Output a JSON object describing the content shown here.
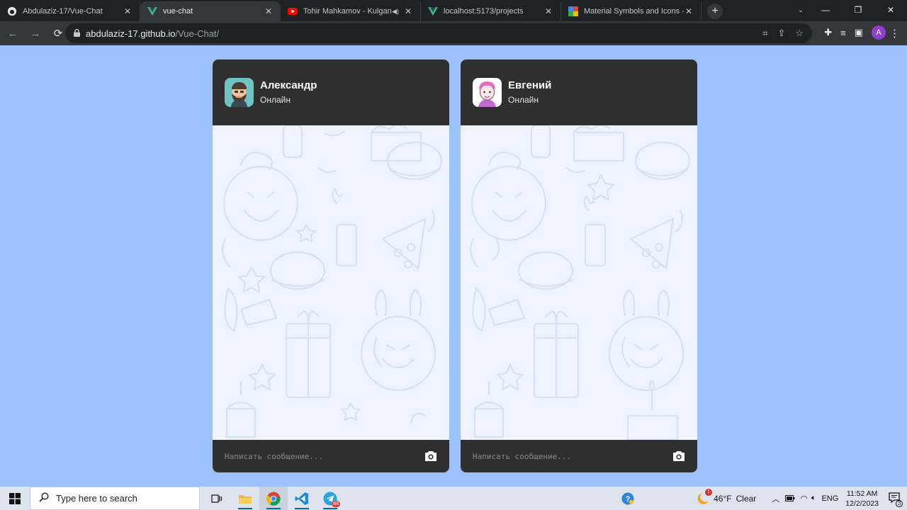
{
  "browser": {
    "tabs": [
      {
        "title": "Abdulaziz-17/Vue-Chat",
        "favicon": "github-icon",
        "active": false
      },
      {
        "title": "vue-chat",
        "favicon": "vue-icon",
        "active": true
      },
      {
        "title": "Tohir Mahkamov - Kulganim",
        "favicon": "youtube-icon",
        "active": false,
        "audio": true
      },
      {
        "title": "localhost:5173/projects",
        "favicon": "vue-icon",
        "active": false
      },
      {
        "title": "Material Symbols and Icons - Go",
        "favicon": "material-icon",
        "active": false
      }
    ],
    "url_host": "abdulaziz-17.github.io",
    "url_path": "/Vue-Chat/",
    "profile_initial": "A"
  },
  "chats": [
    {
      "name": "Александр",
      "status": "Онлайн",
      "input_placeholder": "Написать сообщение...",
      "avatar": "bearded-man-avatar"
    },
    {
      "name": "Евгений",
      "status": "Онлайн",
      "input_placeholder": "Написать сообщение...",
      "avatar": "pink-hair-avatar"
    }
  ],
  "taskbar": {
    "search_placeholder": "Type here to search",
    "weather_temp": "46°F",
    "weather_text": "Clear",
    "weather_alert": "1",
    "language": "ENG",
    "time": "11:52 AM",
    "date": "12/2/2023",
    "notifications": "3",
    "telegram_badge": "88"
  },
  "colors": {
    "page_bg": "#9cc1fc",
    "card_header": "#2f2f2f",
    "chat_bg": "#eef4fe"
  }
}
